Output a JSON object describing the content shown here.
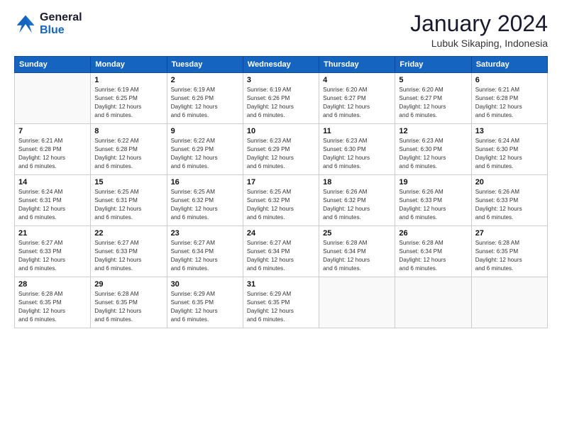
{
  "logo": {
    "line1": "General",
    "line2": "Blue"
  },
  "header": {
    "month_year": "January 2024",
    "location": "Lubuk Sikaping, Indonesia"
  },
  "days_of_week": [
    "Sunday",
    "Monday",
    "Tuesday",
    "Wednesday",
    "Thursday",
    "Friday",
    "Saturday"
  ],
  "weeks": [
    [
      {
        "day": "",
        "info": ""
      },
      {
        "day": "1",
        "info": "Sunrise: 6:19 AM\nSunset: 6:25 PM\nDaylight: 12 hours\nand 6 minutes."
      },
      {
        "day": "2",
        "info": "Sunrise: 6:19 AM\nSunset: 6:26 PM\nDaylight: 12 hours\nand 6 minutes."
      },
      {
        "day": "3",
        "info": "Sunrise: 6:19 AM\nSunset: 6:26 PM\nDaylight: 12 hours\nand 6 minutes."
      },
      {
        "day": "4",
        "info": "Sunrise: 6:20 AM\nSunset: 6:27 PM\nDaylight: 12 hours\nand 6 minutes."
      },
      {
        "day": "5",
        "info": "Sunrise: 6:20 AM\nSunset: 6:27 PM\nDaylight: 12 hours\nand 6 minutes."
      },
      {
        "day": "6",
        "info": "Sunrise: 6:21 AM\nSunset: 6:28 PM\nDaylight: 12 hours\nand 6 minutes."
      }
    ],
    [
      {
        "day": "7",
        "info": "Sunrise: 6:21 AM\nSunset: 6:28 PM\nDaylight: 12 hours\nand 6 minutes."
      },
      {
        "day": "8",
        "info": "Sunrise: 6:22 AM\nSunset: 6:28 PM\nDaylight: 12 hours\nand 6 minutes."
      },
      {
        "day": "9",
        "info": "Sunrise: 6:22 AM\nSunset: 6:29 PM\nDaylight: 12 hours\nand 6 minutes."
      },
      {
        "day": "10",
        "info": "Sunrise: 6:23 AM\nSunset: 6:29 PM\nDaylight: 12 hours\nand 6 minutes."
      },
      {
        "day": "11",
        "info": "Sunrise: 6:23 AM\nSunset: 6:30 PM\nDaylight: 12 hours\nand 6 minutes."
      },
      {
        "day": "12",
        "info": "Sunrise: 6:23 AM\nSunset: 6:30 PM\nDaylight: 12 hours\nand 6 minutes."
      },
      {
        "day": "13",
        "info": "Sunrise: 6:24 AM\nSunset: 6:30 PM\nDaylight: 12 hours\nand 6 minutes."
      }
    ],
    [
      {
        "day": "14",
        "info": "Sunrise: 6:24 AM\nSunset: 6:31 PM\nDaylight: 12 hours\nand 6 minutes."
      },
      {
        "day": "15",
        "info": "Sunrise: 6:25 AM\nSunset: 6:31 PM\nDaylight: 12 hours\nand 6 minutes."
      },
      {
        "day": "16",
        "info": "Sunrise: 6:25 AM\nSunset: 6:32 PM\nDaylight: 12 hours\nand 6 minutes."
      },
      {
        "day": "17",
        "info": "Sunrise: 6:25 AM\nSunset: 6:32 PM\nDaylight: 12 hours\nand 6 minutes."
      },
      {
        "day": "18",
        "info": "Sunrise: 6:26 AM\nSunset: 6:32 PM\nDaylight: 12 hours\nand 6 minutes."
      },
      {
        "day": "19",
        "info": "Sunrise: 6:26 AM\nSunset: 6:33 PM\nDaylight: 12 hours\nand 6 minutes."
      },
      {
        "day": "20",
        "info": "Sunrise: 6:26 AM\nSunset: 6:33 PM\nDaylight: 12 hours\nand 6 minutes."
      }
    ],
    [
      {
        "day": "21",
        "info": "Sunrise: 6:27 AM\nSunset: 6:33 PM\nDaylight: 12 hours\nand 6 minutes."
      },
      {
        "day": "22",
        "info": "Sunrise: 6:27 AM\nSunset: 6:33 PM\nDaylight: 12 hours\nand 6 minutes."
      },
      {
        "day": "23",
        "info": "Sunrise: 6:27 AM\nSunset: 6:34 PM\nDaylight: 12 hours\nand 6 minutes."
      },
      {
        "day": "24",
        "info": "Sunrise: 6:27 AM\nSunset: 6:34 PM\nDaylight: 12 hours\nand 6 minutes."
      },
      {
        "day": "25",
        "info": "Sunrise: 6:28 AM\nSunset: 6:34 PM\nDaylight: 12 hours\nand 6 minutes."
      },
      {
        "day": "26",
        "info": "Sunrise: 6:28 AM\nSunset: 6:34 PM\nDaylight: 12 hours\nand 6 minutes."
      },
      {
        "day": "27",
        "info": "Sunrise: 6:28 AM\nSunset: 6:35 PM\nDaylight: 12 hours\nand 6 minutes."
      }
    ],
    [
      {
        "day": "28",
        "info": "Sunrise: 6:28 AM\nSunset: 6:35 PM\nDaylight: 12 hours\nand 6 minutes."
      },
      {
        "day": "29",
        "info": "Sunrise: 6:28 AM\nSunset: 6:35 PM\nDaylight: 12 hours\nand 6 minutes."
      },
      {
        "day": "30",
        "info": "Sunrise: 6:29 AM\nSunset: 6:35 PM\nDaylight: 12 hours\nand 6 minutes."
      },
      {
        "day": "31",
        "info": "Sunrise: 6:29 AM\nSunset: 6:35 PM\nDaylight: 12 hours\nand 6 minutes."
      },
      {
        "day": "",
        "info": ""
      },
      {
        "day": "",
        "info": ""
      },
      {
        "day": "",
        "info": ""
      }
    ]
  ]
}
